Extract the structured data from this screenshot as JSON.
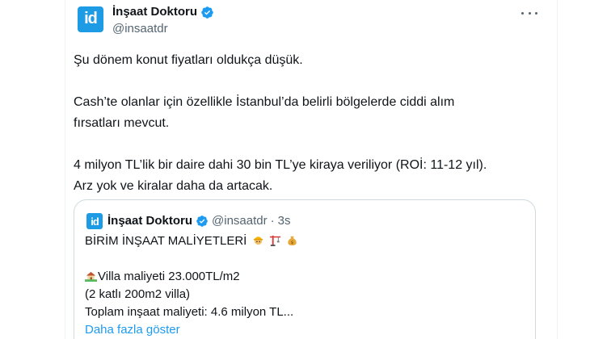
{
  "author": {
    "logo_text": "id",
    "display_name": "İnşaat Doktoru",
    "handle": "@insaatdr",
    "verified": true,
    "brand_color": "#1d9be4"
  },
  "menu_icon": "more-horizontal-icon",
  "tweet": {
    "lines": [
      "Şu dönem konut fiyatları oldukça düşük.",
      "",
      "Cash’te olanlar için özellikle İstanbul’da belirli bölgelerde ciddi alım",
      "fırsatları mevcut.",
      "",
      "4 milyon TL’lik bir daire dahi 30 bin TL’ye kiraya veriliyor (ROİ: 11-12 yıl).",
      "Arz yok ve kiralar daha da artacak."
    ]
  },
  "quote": {
    "logo_text": "id",
    "display_name": "İnşaat Doktoru",
    "handle": "@insaatdr",
    "separator": "·",
    "time": "3s",
    "title": "BİRİM İNŞAAT MALİYETLERİ",
    "title_emojis": [
      "construction-worker-icon",
      "crane-icon",
      "money-bag-icon"
    ],
    "lines": [
      "",
      "Villa maliyeti 23.000TL/m2",
      "(2 katlı 200m2 villa)",
      "Toplam inşaat maliyeti: 4.6 milyon TL..."
    ],
    "villa_emoji": "house-with-garden-icon",
    "show_more": "Daha fazla göster"
  },
  "colors": {
    "text": "#0f1419",
    "secondary": "#536471",
    "link": "#1d9bf0",
    "verified": "#1d9bf0",
    "border": "#cfd9de"
  }
}
